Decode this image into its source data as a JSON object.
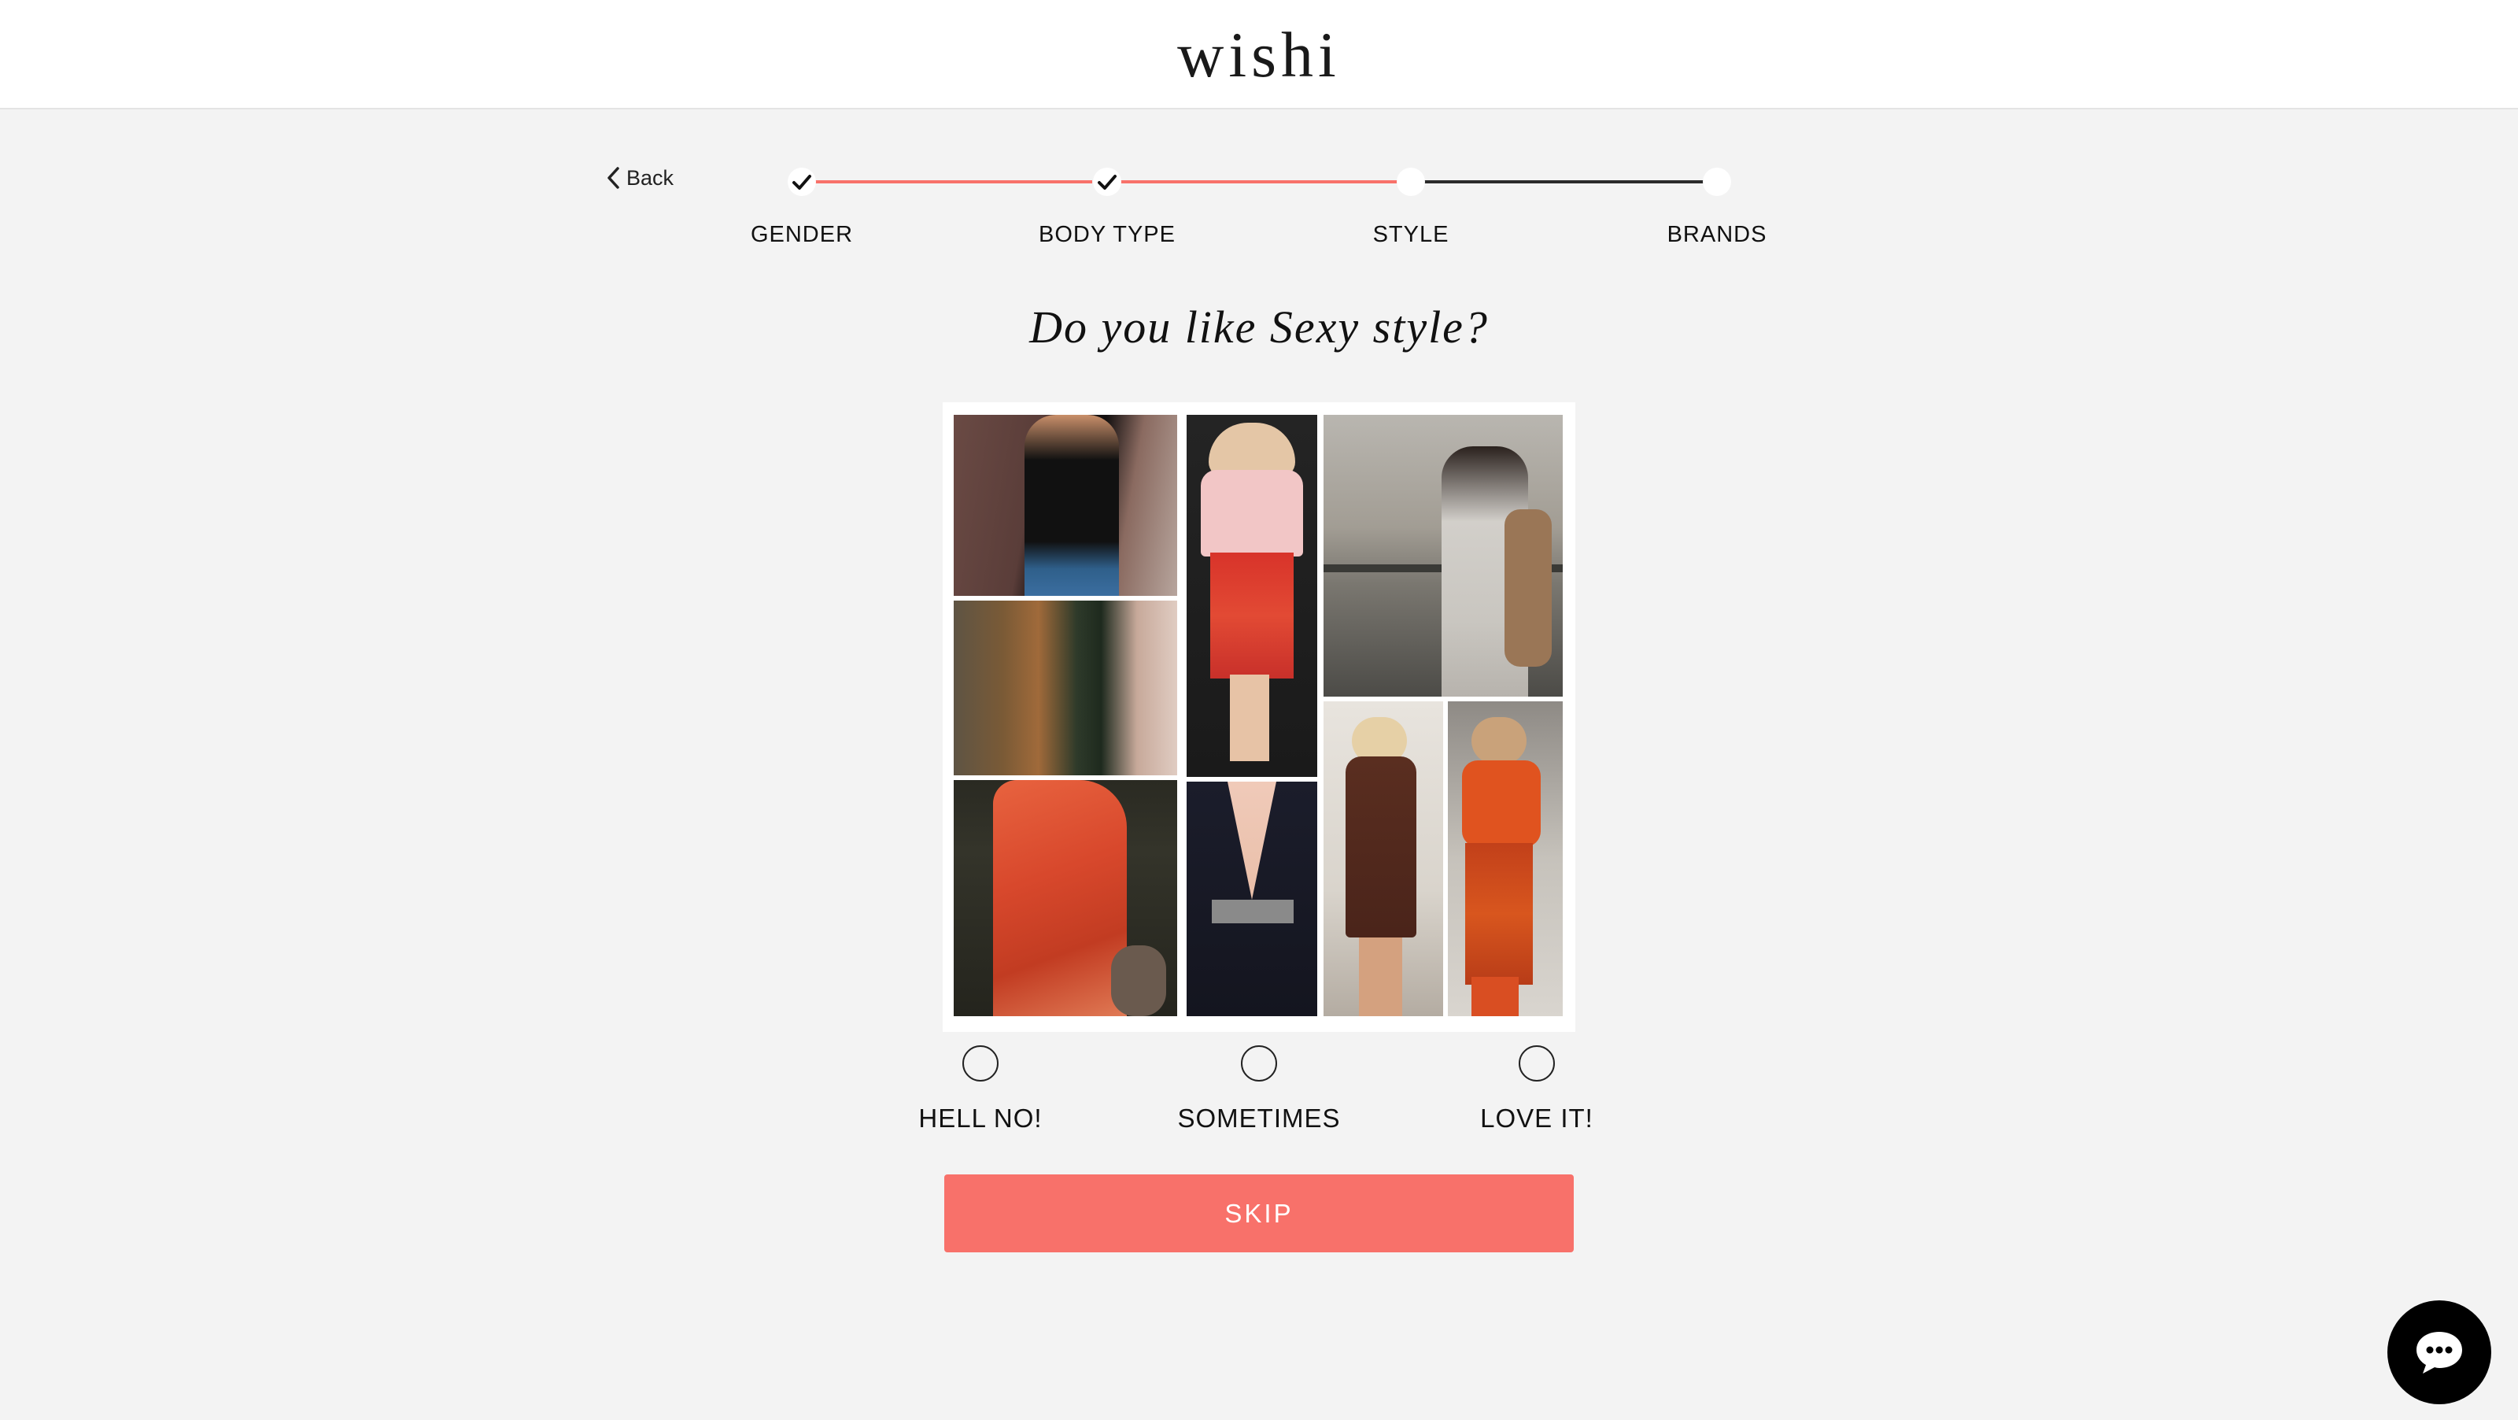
{
  "header": {
    "logo": "wishi"
  },
  "nav": {
    "back_label": "Back"
  },
  "stepper": {
    "steps": [
      {
        "label": "GENDER",
        "status": "complete"
      },
      {
        "label": "BODY TYPE",
        "status": "complete"
      },
      {
        "label": "STYLE",
        "status": "current"
      },
      {
        "label": "BRANDS",
        "status": "pending"
      }
    ],
    "accent_color": "#f8716a"
  },
  "question": "Do you like Sexy style?",
  "collage": {
    "images": [
      "black-top-jeans-outfit",
      "pink-blouse-red-skirt-outfit",
      "grey-slip-dress-outfit",
      "green-dress-group-outfit",
      "red-satin-dress-outfit",
      "black-plunge-dress-outfit",
      "brown-turtleneck-dress-outfit",
      "orange-sequin-outfit"
    ]
  },
  "options": [
    {
      "label": "HELL NO!",
      "selected": false
    },
    {
      "label": "SOMETIMES",
      "selected": false
    },
    {
      "label": "LOVE IT!",
      "selected": false
    }
  ],
  "skip_label": "SKIP",
  "chat": {
    "icon": "chat-bubble-icon"
  }
}
